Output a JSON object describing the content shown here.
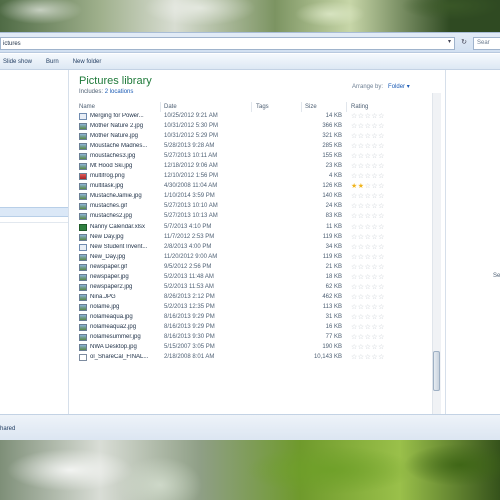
{
  "address": {
    "path": "ictures",
    "search": "Sear"
  },
  "toolbar": {
    "items": [
      "Slide show",
      "Burn",
      "New folder"
    ]
  },
  "library": {
    "title": "Pictures library",
    "includes_label": "Includes:",
    "includes_link": "2 locations",
    "arrange_label": "Arrange by:",
    "arrange_value": "Folder"
  },
  "columns": {
    "name": "Name",
    "date": "Date",
    "tags": "Tags",
    "size": "Size",
    "rating": "Rating"
  },
  "files": [
    {
      "name": "Merging for Power...",
      "date": "10/25/2012 9:21 AM",
      "size": "14 KB",
      "icon": "doc",
      "rating": 0
    },
    {
      "name": "Mother Nature 2.jpg",
      "date": "10/31/2012 5:30 PM",
      "size": "366 KB",
      "icon": "jpg",
      "rating": 0
    },
    {
      "name": "Mother Nature.jpg",
      "date": "10/31/2012 5:29 PM",
      "size": "321 KB",
      "icon": "jpg",
      "rating": 0
    },
    {
      "name": "Moustache Madnes...",
      "date": "5/28/2013 9:28 AM",
      "size": "285 KB",
      "icon": "jpg",
      "rating": 0
    },
    {
      "name": "moustaches3.jpg",
      "date": "5/27/2013 10:11 AM",
      "size": "155 KB",
      "icon": "jpg",
      "rating": 0
    },
    {
      "name": "Mt Hood Ski.jpg",
      "date": "12/18/2012 9:06 AM",
      "size": "23 KB",
      "icon": "jpg",
      "rating": 0
    },
    {
      "name": "multifrog.png",
      "date": "12/10/2012 1:56 PM",
      "size": "4 KB",
      "icon": "png",
      "rating": 0
    },
    {
      "name": "multitask.jpg",
      "date": "4/30/2008 11:04 AM",
      "size": "126 KB",
      "icon": "jpg",
      "rating": 2
    },
    {
      "name": "MustacheJamie.jpg",
      "date": "1/10/2014 3:59 PM",
      "size": "140 KB",
      "icon": "jpg",
      "rating": 0
    },
    {
      "name": "mustaches.gif",
      "date": "5/27/2013 10:10 AM",
      "size": "24 KB",
      "icon": "jpg",
      "rating": 0
    },
    {
      "name": "mustaches2.jpg",
      "date": "5/27/2013 10:13 AM",
      "size": "83 KB",
      "icon": "jpg",
      "rating": 0
    },
    {
      "name": "Nanny Calendar.xlsx",
      "date": "5/7/2013 4:10 PM",
      "size": "11 KB",
      "icon": "xls",
      "rating": 0
    },
    {
      "name": "New Day.jpg",
      "date": "11/7/2012 2:53 PM",
      "size": "119 KB",
      "icon": "jpg",
      "rating": 0
    },
    {
      "name": "New Student Invent...",
      "date": "2/8/2013 4:00 PM",
      "size": "34 KB",
      "icon": "doc",
      "rating": 0
    },
    {
      "name": "New_Day.jpg",
      "date": "11/20/2012 9:00 AM",
      "size": "119 KB",
      "icon": "jpg",
      "rating": 0
    },
    {
      "name": "newspaper.gif",
      "date": "9/5/2012 2:56 PM",
      "size": "21 KB",
      "icon": "jpg",
      "rating": 0
    },
    {
      "name": "newspaper.jpg",
      "date": "5/2/2013 11:48 AM",
      "size": "18 KB",
      "icon": "jpg",
      "rating": 0
    },
    {
      "name": "newspaper2.jpg",
      "date": "5/2/2013 11:53 AM",
      "size": "62 KB",
      "icon": "jpg",
      "rating": 0
    },
    {
      "name": "Nina.JPG",
      "date": "8/26/2013 2:12 PM",
      "size": "462 KB",
      "icon": "jpg",
      "rating": 0
    },
    {
      "name": "nolame.jpg",
      "date": "5/2/2013 12:35 PM",
      "size": "113 KB",
      "icon": "jpg",
      "rating": 0
    },
    {
      "name": "nolameaqua.jpg",
      "date": "8/16/2013 9:29 PM",
      "size": "31 KB",
      "icon": "jpg",
      "rating": 0
    },
    {
      "name": "nolameaqua2.jpg",
      "date": "8/16/2013 9:29 PM",
      "size": "16 KB",
      "icon": "jpg",
      "rating": 0
    },
    {
      "name": "nolamesummer.jpg",
      "date": "8/16/2013 9:30 PM",
      "size": "77 KB",
      "icon": "jpg",
      "rating": 0
    },
    {
      "name": "NWA Desktop.jpg",
      "date": "5/15/2007 3:05 PM",
      "size": "190 KB",
      "icon": "jpg",
      "rating": 0
    },
    {
      "name": "ol_ShareCal_FINAL...",
      "date": "2/18/2008 8:01 AM",
      "size": "10,143 KB",
      "icon": "ppt",
      "rating": 0
    }
  ],
  "preview": {
    "text": "Se"
  },
  "details": {
    "text": "hared"
  },
  "colors": {
    "library_title": "#1f7a3a",
    "link": "#1a5bb5",
    "star_on": "#f0b51f",
    "star_off": "#c3c9d0"
  }
}
